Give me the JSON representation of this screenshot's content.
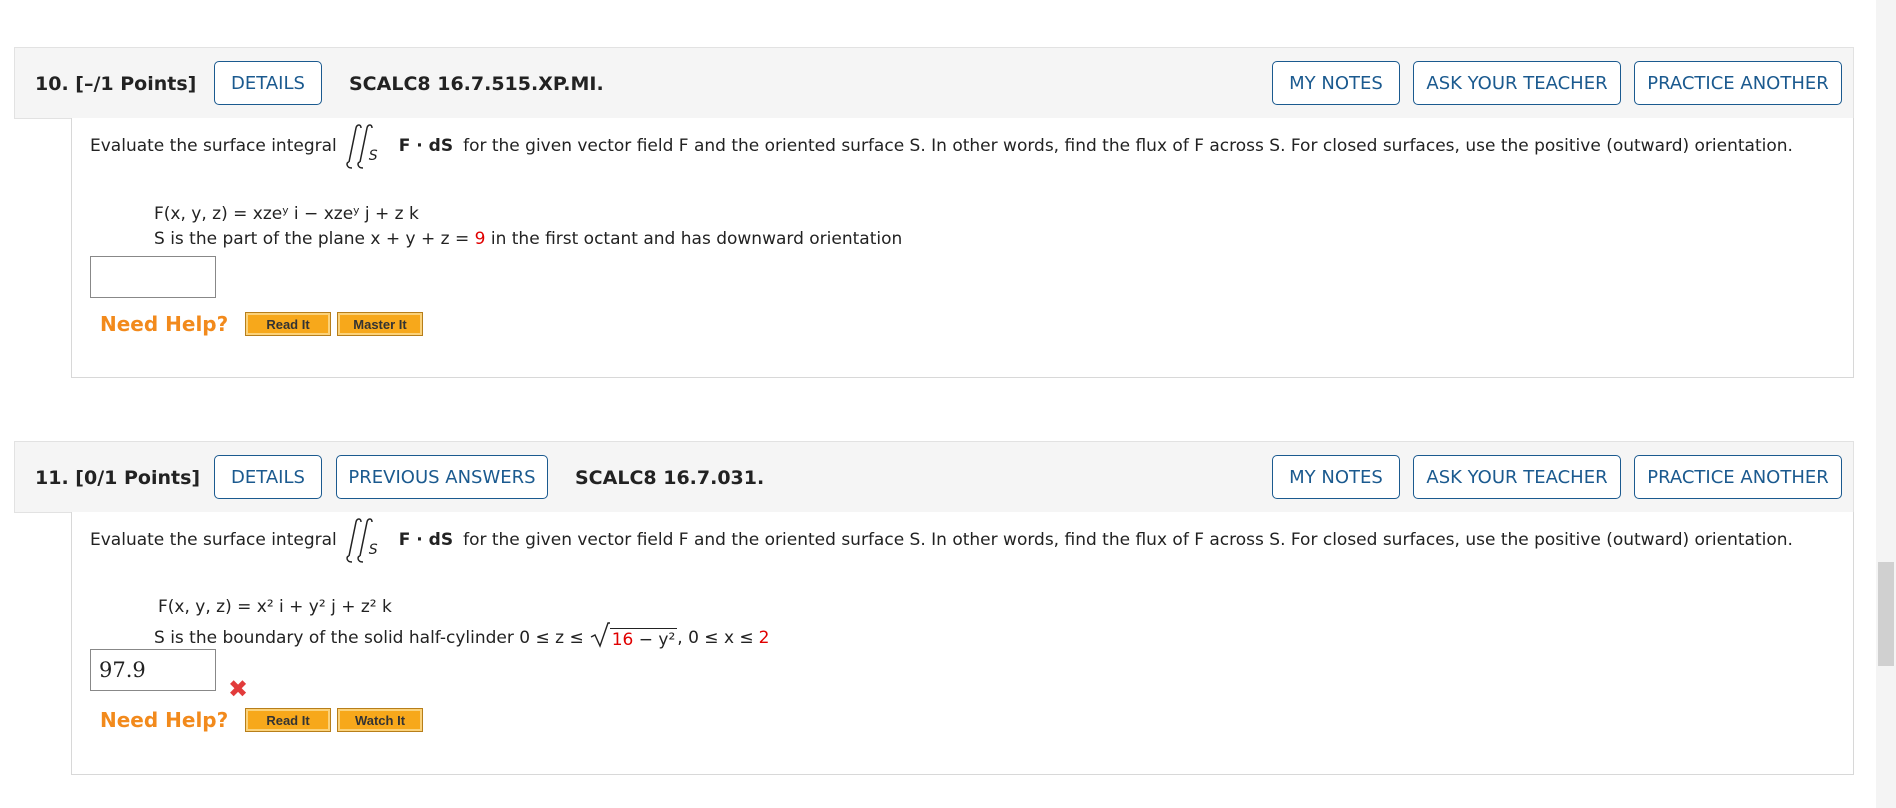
{
  "questions": [
    {
      "number": "10.",
      "points": "[–/1 Points]",
      "details_label": "DETAILS",
      "code": "SCALC8 16.7.515.XP.MI.",
      "my_notes": "MY NOTES",
      "ask_teacher": "ASK YOUR TEACHER",
      "practice_another": "PRACTICE ANOTHER",
      "prompt_before": "Evaluate the surface integral",
      "integral_sub": "S",
      "prompt_F": "F · dS",
      "prompt_after": "for the given vector field F and the oriented surface S. In other words, find the flux of F across S. For closed surfaces, use the positive (outward) orientation.",
      "field_line": "F(x, y, z) = xzeʸ i − xzeʸ j + z k",
      "surface_line_before": "S is the part of the plane x + y + z =",
      "surface_value": "9",
      "surface_line_after": "in the first octant and has downward orientation",
      "answer": "",
      "need_help": "Need Help?",
      "help_buttons": [
        "Read It",
        "Master It"
      ]
    },
    {
      "number": "11.",
      "points": "[0/1 Points]",
      "details_label": "DETAILS",
      "previous_answers": "PREVIOUS ANSWERS",
      "code": "SCALC8 16.7.031.",
      "my_notes": "MY NOTES",
      "ask_teacher": "ASK YOUR TEACHER",
      "practice_another": "PRACTICE ANOTHER",
      "prompt_before": "Evaluate the surface integral",
      "integral_sub": "S",
      "prompt_F": "F · dS",
      "prompt_after": "for the given vector field F and the oriented surface S. In other words, find the flux of F across S. For closed surfaces, use the positive (outward) orientation.",
      "field_line": "F(x, y, z) = x² i + y² j + z² k",
      "surface_line_before": "S is the boundary of the solid half-cylinder  0 ≤ z ≤",
      "sqrt_value": "16",
      "sqrt_rest": " − y²",
      "surface_line_mid": ", 0 ≤ x ≤",
      "surface_value": "2",
      "answer": "97.9",
      "need_help": "Need Help?",
      "help_buttons": [
        "Read It",
        "Watch It"
      ]
    }
  ],
  "icons": {
    "incorrect": "x-mark-icon"
  },
  "colors": {
    "accent": "#1b5a8f",
    "error": "#e00000",
    "help": "#f28a1c",
    "help_button": "#f7a81b"
  }
}
